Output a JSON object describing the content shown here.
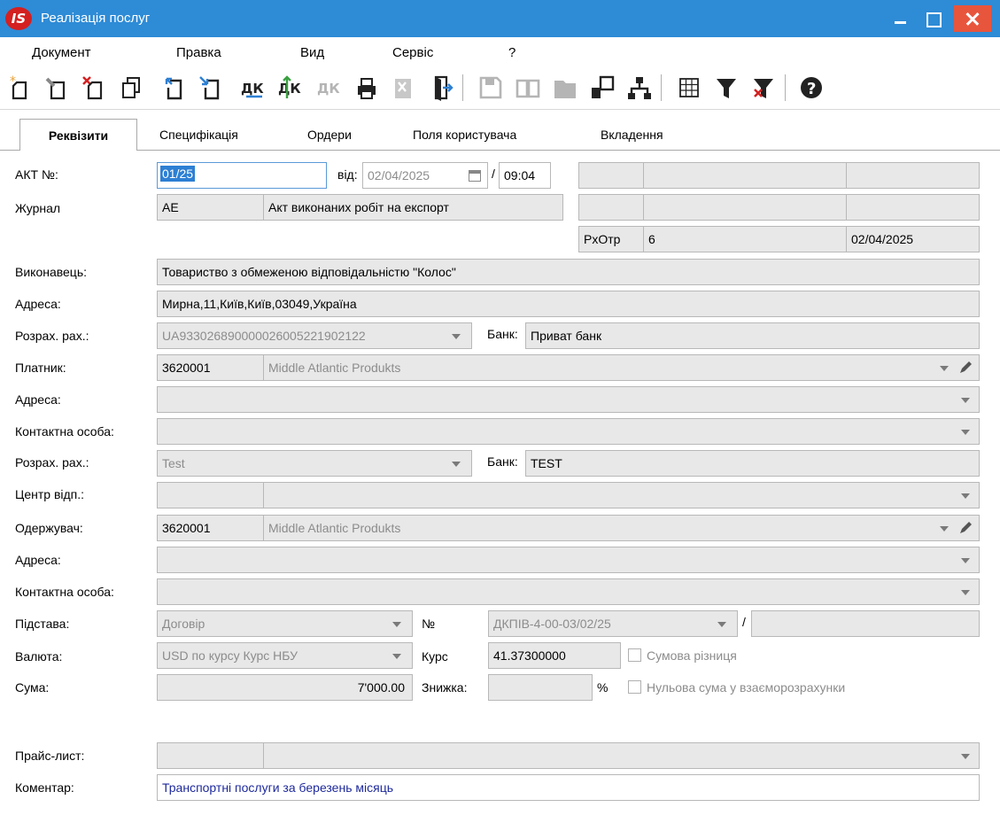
{
  "window": {
    "logo_text": "IS",
    "title": "Реалізація послуг"
  },
  "menu": [
    "Документ",
    "Правка",
    "Вид",
    "Сервіс",
    "?"
  ],
  "tabs": [
    "Реквізити",
    "Специфікація",
    "Ордери",
    "Поля користувача",
    "Вкладення"
  ],
  "form": {
    "act_label": "АКТ №:",
    "act_number": "01/25",
    "from_label": "від:",
    "date": "02/04/2025",
    "slash": "/",
    "time": "09:04",
    "journal_label": "Журнал",
    "journal_code": "АЕ",
    "journal_name": "Акт виконаних робіт на експорт",
    "rxotr_label": "РхОтр",
    "rxotr_value": "6",
    "rxotr_date": "02/04/2025",
    "executor_label": "Виконавець:",
    "executor_value": "Товариство з обмеженою відповідальністю \"Колос\"",
    "address1_label": "Адреса:",
    "address1_value": "Мирна,11,Київ,Київ,03049,Україна",
    "account1_label": "Розрах. рах.:",
    "account1_value": "UA933026890000026005221902122",
    "bank1_label": "Банк:",
    "bank1_value": "Приват банк",
    "payer_label": "Платник:",
    "payer_code": "3620001",
    "payer_name": "Middle Atlantic Produkts",
    "address2_label": "Адреса:",
    "contact1_label": "Контактна особа:",
    "account2_label": "Розрах. рах.:",
    "account2_value": "Test",
    "bank2_label": "Банк:",
    "bank2_value": "TEST",
    "center_label": "Центр відп.:",
    "receiver_label": "Одержувач:",
    "receiver_code": "3620001",
    "receiver_name": "Middle Atlantic Produkts",
    "address3_label": "Адреса:",
    "contact2_label": "Контактна особа:",
    "basis_label": "Підстава:",
    "basis_value": "Договір",
    "no_label": "№",
    "basis_number": "ДКПІВ-4-00-03/02/25",
    "basis_slash": "/",
    "currency_label": "Валюта:",
    "currency_value": "USD по курсу Курс НБУ",
    "rate_label": "Курс",
    "rate_value": "41.37300000",
    "sum_diff_label": "Сумова різниця",
    "sum_label": "Сума:",
    "sum_value": "7'000.00",
    "discount_label": "Знижка:",
    "percent_sign": "%",
    "zero_sum_label": "Нульова сума у взаєморозрахунки",
    "price_list_label": "Прайс-лист:",
    "comment_label": "Коментар:",
    "comment_value": "Транспортні послуги за березень місяць"
  },
  "colors": {
    "titlebar": "#2e8bd6",
    "close": "#e8553d",
    "selection": "#2d7fd3",
    "comment_text": "#1e2a9c"
  }
}
